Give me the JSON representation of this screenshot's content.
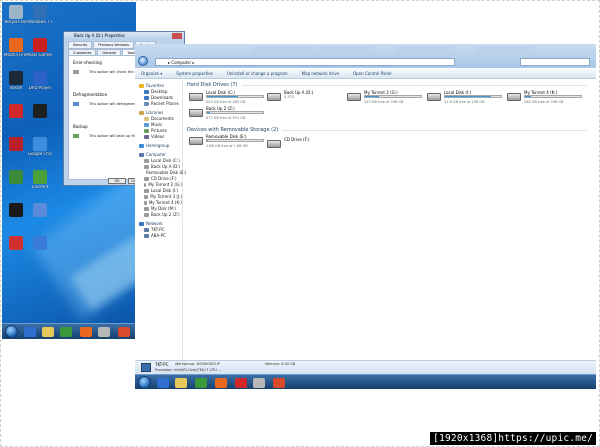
{
  "desktop": {
    "icons": [
      {
        "label": "Recycle Bin",
        "color": "#9db4c8"
      },
      {
        "label": "Windows 7 USB DVD",
        "color": "#2f6fb8"
      },
      {
        "label": "Mozilla Firefox",
        "color": "#e8681f"
      },
      {
        "label": "KOEI Games",
        "color": "#c82020"
      },
      {
        "label": "Steam",
        "color": "#1b2838"
      },
      {
        "label": "DVD Player",
        "color": "#2a62c9"
      },
      {
        "label": "",
        "color": "#d02828"
      },
      {
        "label": "",
        "color": "#202020"
      },
      {
        "label": "",
        "color": "#b8202a"
      },
      {
        "label": "Google Chrome",
        "color": "#3d8ee0"
      },
      {
        "label": "",
        "color": "#3a8a3a"
      },
      {
        "label": "uTorrent",
        "color": "#4aa03a"
      },
      {
        "label": "",
        "color": "#1a1a1a"
      },
      {
        "label": "",
        "color": "#5a8ad8"
      },
      {
        "label": "",
        "color": "#d03030"
      },
      {
        "label": "",
        "color": "#3a7ad8"
      }
    ]
  },
  "properties_dialog": {
    "title": "Back Up A (D:) Properties",
    "tabs": [
      "Security",
      "Previous Versions",
      "Quota",
      "Customize",
      "General",
      "Tools",
      "Hardware",
      "Sharing"
    ],
    "active_tab": "Tools",
    "sections": [
      {
        "heading": "Error-checking",
        "text": "This option will check the drive for errors."
      },
      {
        "heading": "Defragmentation",
        "text": "This option will defragment files on the drive."
      },
      {
        "heading": "Backup",
        "text": "This option will back up files on the drive."
      }
    ],
    "ok_label": "OK",
    "cancel_label": "Cancel"
  },
  "explorer": {
    "address": "Computer",
    "ghost_tabs": [
      "",
      "",
      "",
      ""
    ],
    "command_bar": [
      "Organize ▾",
      "System properties",
      "Uninstall or change a program",
      "Map network drive",
      "Open Control Panel"
    ],
    "nav": [
      {
        "label": "Favorites",
        "level": 1,
        "color": "#e8b72a"
      },
      {
        "label": "Desktop",
        "level": 2,
        "color": "#3a78c2"
      },
      {
        "label": "Downloads",
        "level": 2,
        "color": "#3a78c2"
      },
      {
        "label": "Recent Places",
        "level": 2,
        "color": "#6a8fbf"
      },
      {
        "label": "Libraries",
        "level": 1,
        "color": "#c9a24a",
        "gap": true
      },
      {
        "label": "Documents",
        "level": 2,
        "color": "#d9c27a"
      },
      {
        "label": "Music",
        "level": 2,
        "color": "#5a9ad8"
      },
      {
        "label": "Pictures",
        "level": 2,
        "color": "#6aa05a"
      },
      {
        "label": "Videos",
        "level": 2,
        "color": "#6a6a9a"
      },
      {
        "label": "Homegroup",
        "level": 1,
        "color": "#3a8ad8",
        "gap": true
      },
      {
        "label": "Computer",
        "level": 1,
        "color": "#5a7aa8",
        "gap": true
      },
      {
        "label": "Local Disk (C:)",
        "level": 2,
        "color": "#9a9a9a"
      },
      {
        "label": "Back Up A (D:)",
        "level": 2,
        "color": "#9a9a9a"
      },
      {
        "label": "Removable Disk (E:)",
        "level": 2,
        "color": "#9a9a9a"
      },
      {
        "label": "CD Drive (F:)",
        "level": 2,
        "color": "#9a9a9a"
      },
      {
        "label": "My Torrent 2 (G:)",
        "level": 2,
        "color": "#9a9a9a"
      },
      {
        "label": "Local Disk (I:)",
        "level": 2,
        "color": "#9a9a9a"
      },
      {
        "label": "My Torrent 3 (J:)",
        "level": 2,
        "color": "#9a9a9a"
      },
      {
        "label": "My Torrent 4 (K:)",
        "level": 2,
        "color": "#9a9a9a"
      },
      {
        "label": "My Disk (M:)",
        "level": 2,
        "color": "#9a9a9a"
      },
      {
        "label": "Back Up 2 (Z:)",
        "level": 2,
        "color": "#9a9a9a"
      },
      {
        "label": "Network",
        "level": 1,
        "color": "#3a78c2",
        "gap": true
      },
      {
        "label": "TKT-PC",
        "level": 2,
        "color": "#5a7aa8"
      },
      {
        "label": "ABA-PC",
        "level": 2,
        "color": "#5a7aa8"
      }
    ],
    "hdd_header": "Hard Disk Drives (7)",
    "drives": [
      {
        "name": "Local Disk (C:)",
        "free": "203 GB free of 465 GB",
        "used": 0.56
      },
      {
        "name": "Back Up A (D:)",
        "free": "0.3TG",
        "used": 0.0
      },
      {
        "name": "My Torrent 2 (G:)",
        "free": "223 GB free of 298 GB",
        "used": 0.25
      },
      {
        "name": "Local Disk (I:)",
        "free": "51.6 GB free of 298 GB",
        "used": 0.83
      },
      {
        "name": "My Torrent 4 (K:)",
        "free": "265 GB free of 298 GB",
        "used": 0.11
      },
      {
        "name": "Back Up 2 (Z:)",
        "free": "877 GB free of 931 GB",
        "used": 0.06
      }
    ],
    "removable_header": "Devices with Removable Storage (2)",
    "removable": [
      {
        "name": "Removable Disk (E:)",
        "free": "1.88 GB free of 1.88 GB",
        "used": 0.02
      },
      {
        "name": "CD Drive (F:)",
        "free": "",
        "used": null
      }
    ],
    "detail": {
      "name": "TKT-PC",
      "workgroup": "Workgroup: WORKGROUP",
      "memory": "Memory: 8.00 GB",
      "processor": "Processor: Intel(R) Core(TM) i7 CPU ..."
    }
  },
  "caption": "[1920x1368]https://upic.me/"
}
